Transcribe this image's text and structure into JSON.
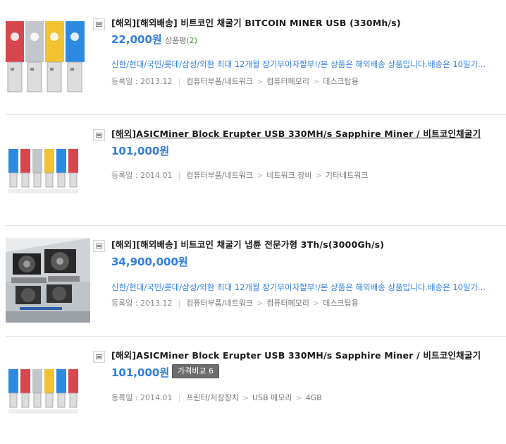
{
  "items": [
    {
      "title": "[해외][해외배송] 비트코인 채굴기 BITCOIN MINER USB (330Mh/s)",
      "price": "22,000원",
      "review_label": "상품평",
      "review_count": "(2)",
      "desc": "신한/현대/국민/롯데/삼성/외환 최대 12개월 장기무이자할부!/본 상품은 해외배송 상품입니다.배송은 10일가...",
      "date": "등록일 : 2013.12",
      "cat1": "컴퓨터부품/네트워크",
      "cat2": "컴퓨터메모리",
      "cat3": "데스크탑용"
    },
    {
      "title": "[해외]ASICMiner Block Erupter USB 330MH/s Sapphire Miner / 비트코인채굴기",
      "price": "101,000원",
      "date": "등록일 : 2014.01",
      "cat1": "컴퓨터부품/네트워크",
      "cat2": "네트워크 장비",
      "cat3": "기타네트워크"
    },
    {
      "title": "[해외][해외배송] 비트코인 채굴기 냅튠 전문가형 3Th/s(3000Gh/s)",
      "price": "34,900,000원",
      "desc": "신한/현대/국민/롯데/삼성/외환 최대 12개월 장기무이자할부!/본 상품은 해외배송 상품입니다.배송은 10일가...",
      "date": "등록일 : 2013.12",
      "cat1": "컴퓨터부품/네트워크",
      "cat2": "컴퓨터메모리",
      "cat3": "데스크탑용"
    },
    {
      "title": "[해외]ASICMiner Block Erupter USB 330MH/s Sapphire Miner / 비트코인채굴기",
      "price": "101,000원",
      "compare_label": "가격비교 6",
      "date": "등록일 : 2014.01",
      "cat1": "프린터/저장장치",
      "cat2": "USB 메모리",
      "cat3": "4GB"
    }
  ],
  "colors": {
    "price": "#2f7de1",
    "review_count": "#3aa02a",
    "usb_red": "#d8454f",
    "usb_silver": "#bfc3c7",
    "usb_yellow": "#f2c230",
    "usb_blue": "#2c8be0"
  }
}
